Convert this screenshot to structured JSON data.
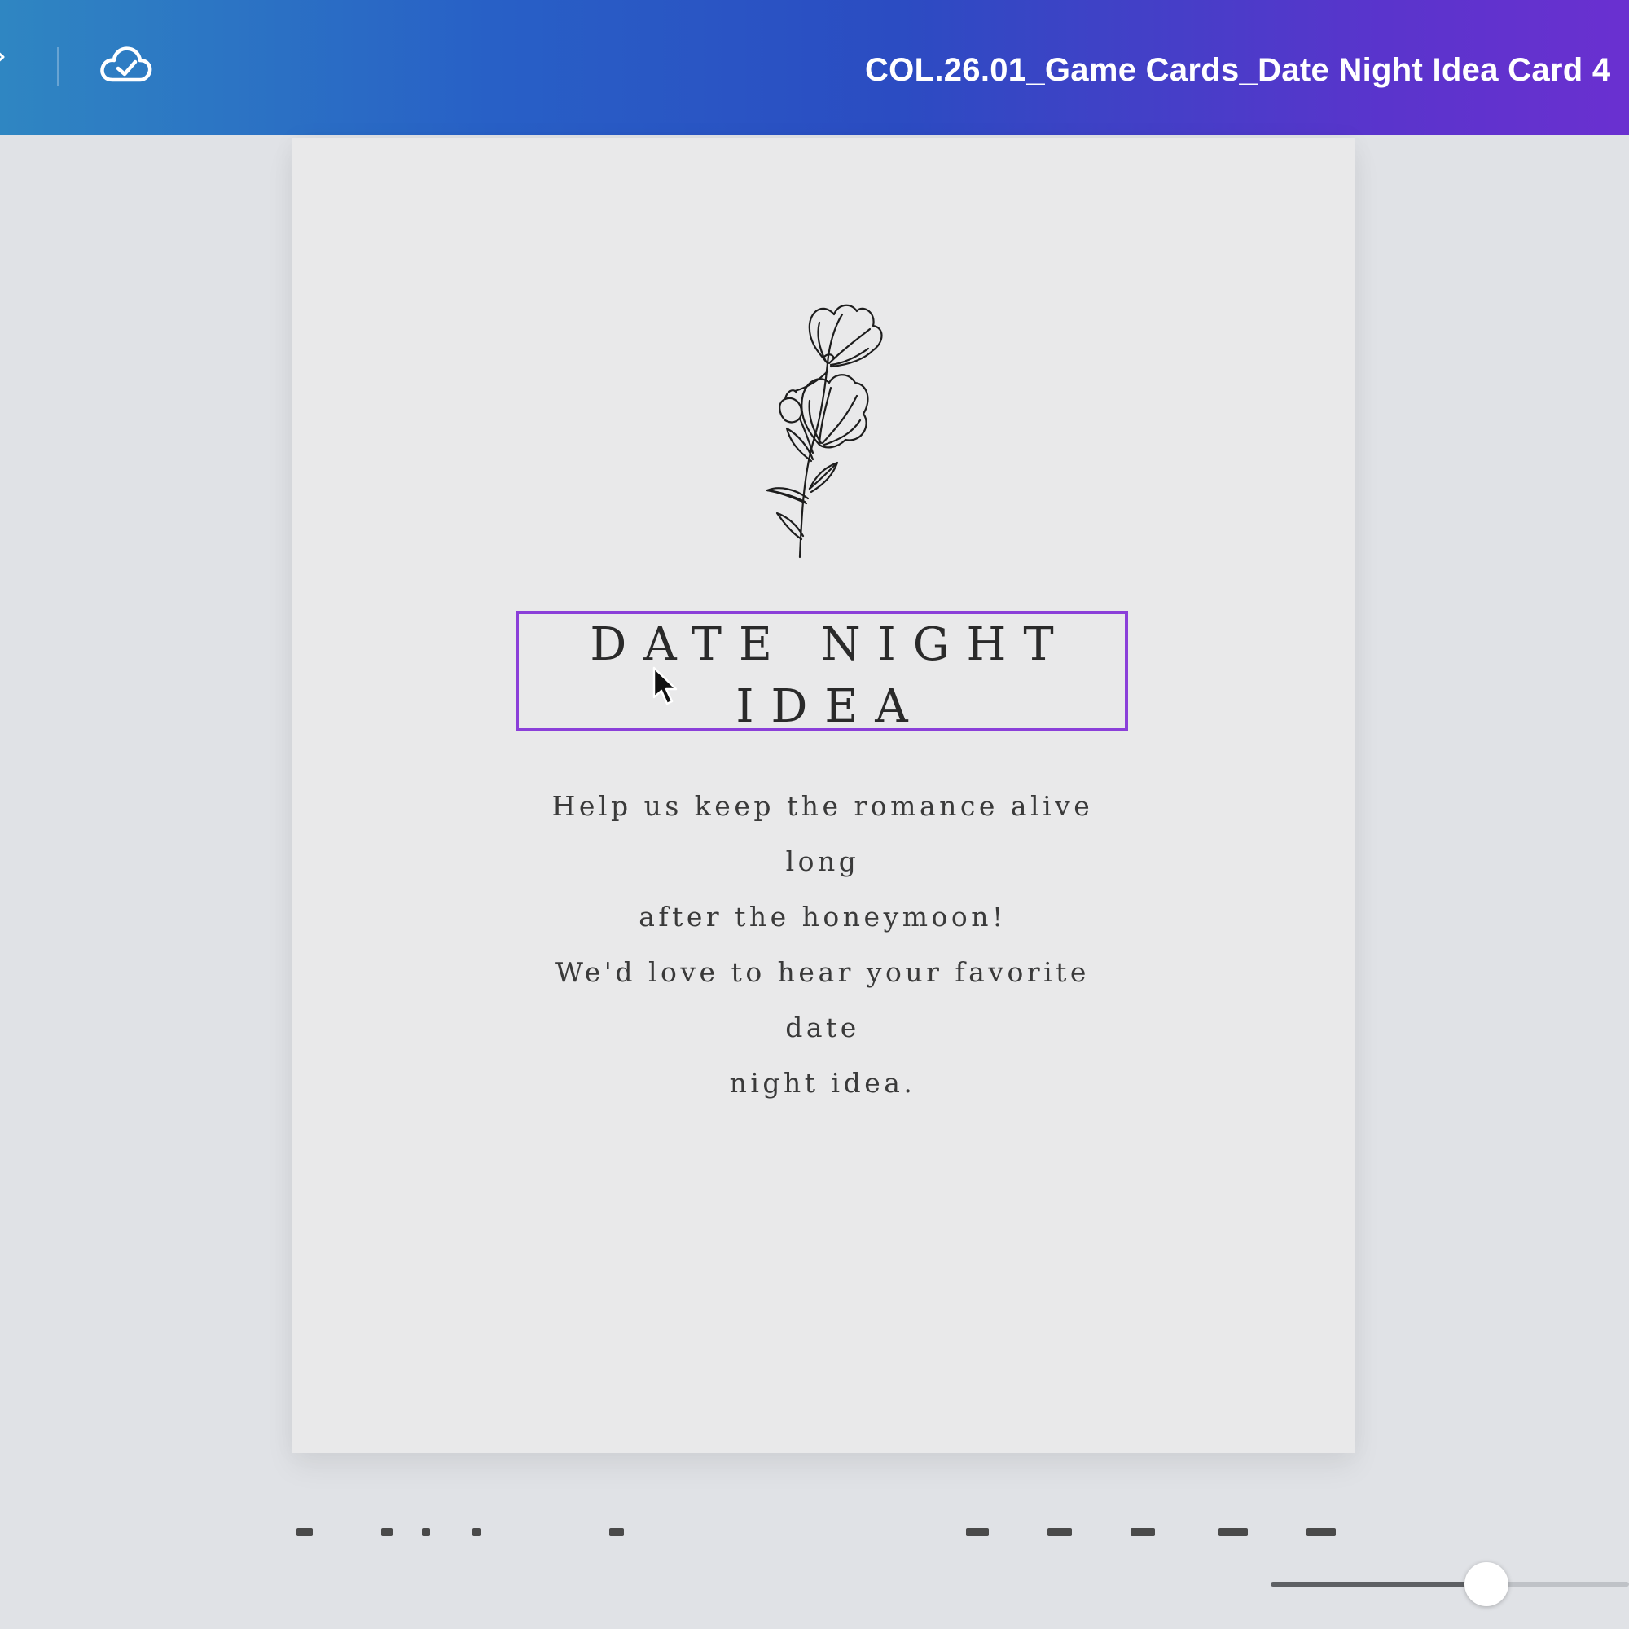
{
  "header": {
    "document_title": "COL.26.01_Game Cards_Date Night Idea Card 4",
    "save_status_icon": "cloud-check-icon"
  },
  "card": {
    "icon": "flower-illustration",
    "title_lines": [
      "DATE NIGHT",
      "IDEA"
    ],
    "paragraph_1_lines": [
      "Help us keep the romance alive long",
      "after the honeymoon!"
    ],
    "paragraph_2_lines": [
      "We'd love to hear your favorite date",
      "night idea."
    ],
    "selection_color": "#8b3fd9"
  },
  "colors": {
    "topbar_start": "#2f86c2",
    "topbar_end": "#6a30d0",
    "canvas_bg": "#e0e2e6",
    "page_bg": "#e9e9ea"
  },
  "zoom": {
    "level_fraction": 0.6
  }
}
